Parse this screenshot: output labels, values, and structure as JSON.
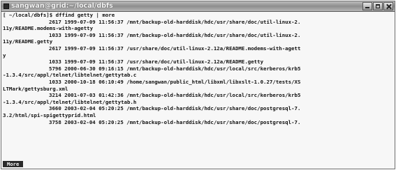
{
  "window": {
    "title": "sangwan@grid:~/local/dbfs"
  },
  "terminal": {
    "lines": [
      {
        "text": "[ ~/local/dbfs]$ dffind getty | more",
        "indent": false
      },
      {
        "text": "2617 1999-07-09 11:56:37 /mnt/backup-old-harddisk/hdc/usr/share/doc/util-linux-2.",
        "indent": true
      },
      {
        "text": "11y/README.modems-with-agetty",
        "indent": false
      },
      {
        "text": "1033 1999-07-09 11:56:37 /mnt/backup-old-harddisk/hdc/usr/share/doc/util-linux-2.",
        "indent": true
      },
      {
        "text": "11y/README.getty",
        "indent": false
      },
      {
        "text": "2617 1999-07-09 11:56:37 /usr/share/doc/util-linux-2.12a/README.modems-with-agett",
        "indent": true
      },
      {
        "text": "y",
        "indent": false
      },
      {
        "text": "1033 1999-07-09 11:56:37 /usr/share/doc/util-linux-2.12a/README.getty",
        "indent": true
      },
      {
        "text": "5796 2000-06-30 09:16:15 /mnt/backup-old-harddisk/hdc/usr/local/src/kerberos/krb5",
        "indent": true
      },
      {
        "text": "-1.3.4/src/appl/telnet/libtelnet/gettytab.c",
        "indent": false
      },
      {
        "text": "1033 2000-10-18 06:10:49 /home/sangwan/public_html/libxml/libxslt-1.0.27/tests/XS",
        "indent": true
      },
      {
        "text": "LTMark/gettysburg.xml",
        "indent": false
      },
      {
        "text": "3214 2001-07-03 01:42:36 /mnt/backup-old-harddisk/hdc/usr/local/src/kerberos/krb5",
        "indent": true
      },
      {
        "text": "-1.3.4/src/appl/telnet/libtelnet/gettytab.h",
        "indent": false
      },
      {
        "text": "3660 2003-02-04 05:20:25 /mnt/backup-old-harddisk/hdc/usr/share/doc/postgresql-7.",
        "indent": true
      },
      {
        "text": "3.2/html/spi-spigettyprid.html",
        "indent": false
      },
      {
        "text": "3758 2003-02-04 05:20:25 /mnt/backup-old-harddisk/hdc/usr/share/doc/postgresql-7.",
        "indent": true
      }
    ],
    "pager_prompt": "More"
  },
  "colors": {
    "terminal_background": "#f7f7f7",
    "terminal_text": "#111111",
    "titlebar": "#8d8d8d",
    "pager_background": "#2b2b2b"
  },
  "icons": {
    "window_icon": "terminal-window-icon",
    "minimize": "minimize-icon",
    "maximize": "maximize-icon",
    "close": "close-icon"
  }
}
